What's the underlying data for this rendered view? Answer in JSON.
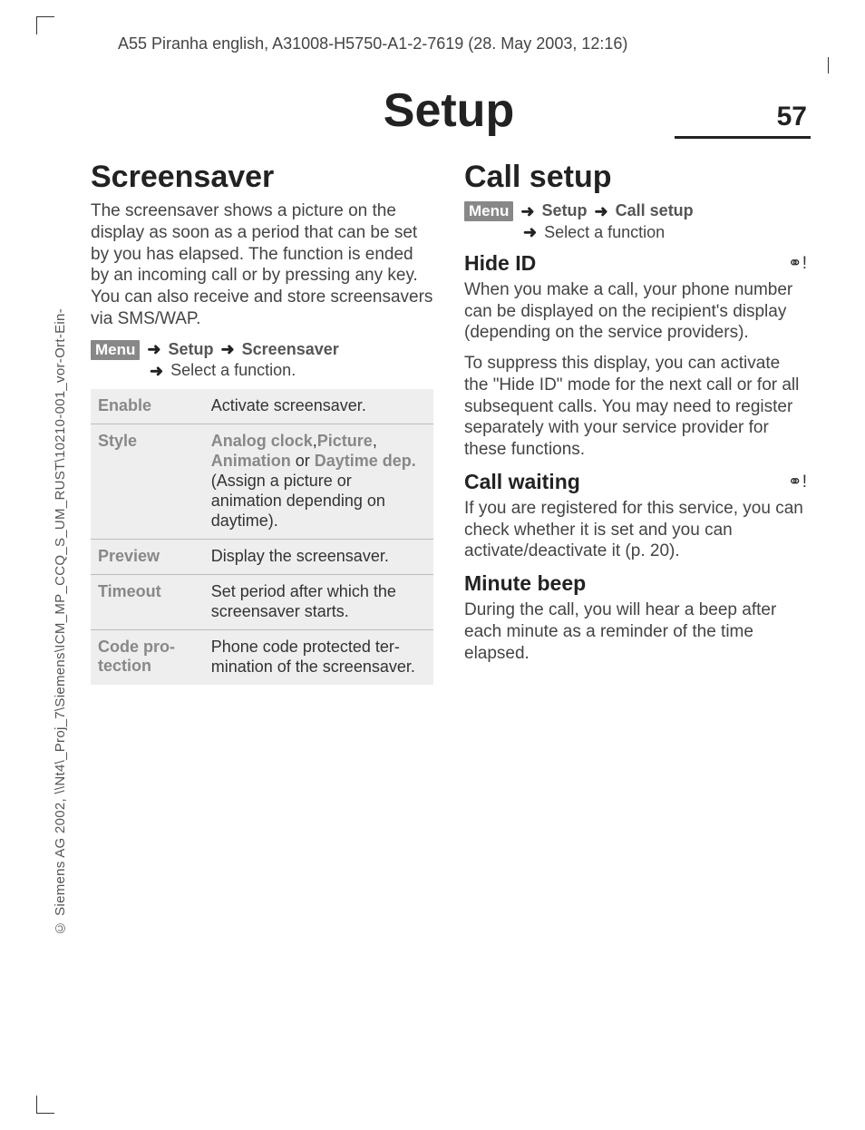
{
  "meta": {
    "header_line": "A55 Piranha english, A31008-H5750-A1-2-7619 (28. May 2003, 12:16)",
    "spine_line": "© Siemens AG 2002, \\\\Nt4\\_Proj_7\\Siemens\\ICM_MP_CCQ_S_UM_RUST\\10210-001_vor-Ort-Ein-"
  },
  "chapter": {
    "title": "Setup",
    "page_number": "57"
  },
  "menu_label": "Menu",
  "arrow_glyph": "➜",
  "network_glyph": "⚭!",
  "left": {
    "heading": "Screensaver",
    "para1": "The screensaver shows a picture on the display as soon as a period that can be set by you has elapsed. The function is ended by an incoming call or by pressing any key. You can also receive and store screensavers via SMS/WAP.",
    "path_setup": "Setup",
    "path_screensaver": "Screensaver",
    "path_select": "Select a function.",
    "table": {
      "enable": {
        "label": "Enable",
        "desc": "Activate screensaver."
      },
      "style": {
        "label": "Style",
        "em1": "Analog clock",
        "em_sep1": ",",
        "em2": "Picture",
        "em_sep2": ", ",
        "em3": "Animation",
        "or": " or ",
        "em4": "Daytime dep.",
        "rest": " (Assign a picture or animation depending on daytime)."
      },
      "preview": {
        "label": "Preview",
        "desc": "Display the screensaver."
      },
      "timeout": {
        "label": "Timeout",
        "desc": "Set period after which the screensaver starts."
      },
      "codepro": {
        "label": "Code pro­tection",
        "desc": "Phone code protected ter­mination of the screen­saver."
      }
    }
  },
  "right": {
    "heading": "Call setup",
    "path_setup": "Setup",
    "path_callsetup": "Call setup",
    "path_select": "Select a function",
    "hide_id": {
      "title": "Hide ID",
      "p1": "When you make a call, your phone number can be displayed on the re­cipient's display (depending on the service providers).",
      "p2": "To suppress this display, you can activate the \"Hide ID\" mode for the next call or for all subsequent calls. You may need to register separately with your service provider for these functions."
    },
    "call_waiting": {
      "title": "Call waiting",
      "p1": "If you are registered for this service, you can check whether it is set and you can activate/deactivate it (p. 20)."
    },
    "minute_beep": {
      "title": "Minute beep",
      "p1": "During the call, you will hear a beep after each minute as a reminder of the time elapsed."
    }
  }
}
